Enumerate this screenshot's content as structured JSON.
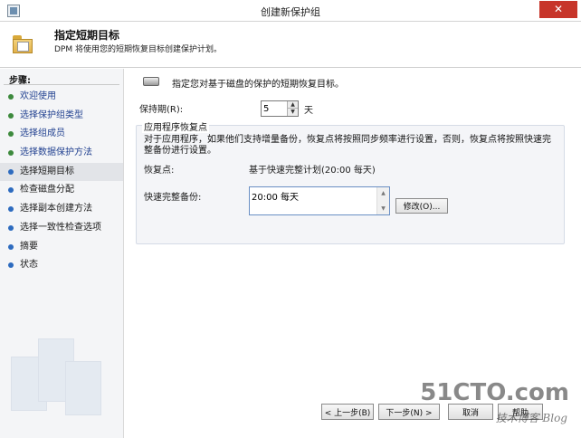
{
  "window": {
    "title": "创建新保护组",
    "close_glyph": "✕"
  },
  "header": {
    "title": "指定短期目标",
    "subtitle": "DPM 将使用您的短期恢复目标创建保护计划。"
  },
  "nav": {
    "label": "步骤:",
    "items": [
      {
        "label": "欢迎使用"
      },
      {
        "label": "选择保护组类型"
      },
      {
        "label": "选择组成员"
      },
      {
        "label": "选择数据保护方法"
      },
      {
        "label": "选择短期目标"
      },
      {
        "label": "检查磁盘分配"
      },
      {
        "label": "选择副本创建方法"
      },
      {
        "label": "选择一致性检查选项"
      },
      {
        "label": "摘要"
      },
      {
        "label": "状态"
      }
    ]
  },
  "main": {
    "intro": "指定您对基于磁盘的保护的短期恢复目标。",
    "retention_label": "保持期(R):",
    "retention_value": "5",
    "retention_unit": "天",
    "group_title": "应用程序恢复点",
    "group_desc": "对于应用程序，如果他们支持增量备份，恢复点将按照同步频率进行设置，否则，恢复点将按照快速完整备份进行设置。",
    "recovery_points_label": "恢复点:",
    "recovery_points_value": "基于快速完整计划(20:00 每天)",
    "fast_full_label": "快速完整备份:",
    "fast_full_value": "20:00 每天",
    "modify_label": "修改(O)..."
  },
  "buttons": {
    "prev": "< 上一步(B)",
    "next": "下一步(N) >",
    "cancel": "取消",
    "help": "帮助"
  },
  "watermark": {
    "main": "51CTO.com",
    "sub": "技术博客 Blog"
  }
}
